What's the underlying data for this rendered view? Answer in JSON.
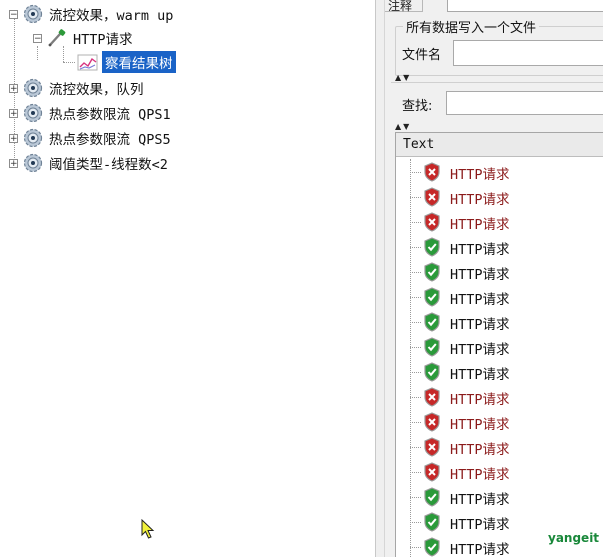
{
  "tree": {
    "items": [
      {
        "label": "流控效果，warm up",
        "expander": "−",
        "level": 0,
        "selected": false
      },
      {
        "label": "HTTP请求",
        "expander": "−",
        "level": 1,
        "selected": false
      },
      {
        "label": "察看结果树",
        "expander": "",
        "level": 2,
        "selected": true
      },
      {
        "label": "流控效果，队列",
        "expander": "+",
        "level": 0,
        "selected": false
      },
      {
        "label": "热点参数限流 QPS1",
        "expander": "+",
        "level": 0,
        "selected": false
      },
      {
        "label": "热点参数限流 QPS5",
        "expander": "+",
        "level": 0,
        "selected": false
      },
      {
        "label": "阈值类型-线程数<2",
        "expander": "+",
        "level": 0,
        "selected": false
      }
    ]
  },
  "right": {
    "top_tab_label": "注释",
    "file_group_title": "所有数据写入一个文件",
    "file_label": "文件名",
    "file_value": "",
    "search_label": "查找:",
    "search_value": "",
    "split_arrows": "▲▼"
  },
  "results": {
    "header": "Text",
    "items": [
      {
        "label": "HTTP请求",
        "status": "fail"
      },
      {
        "label": "HTTP请求",
        "status": "fail"
      },
      {
        "label": "HTTP请求",
        "status": "fail"
      },
      {
        "label": "HTTP请求",
        "status": "ok"
      },
      {
        "label": "HTTP请求",
        "status": "ok"
      },
      {
        "label": "HTTP请求",
        "status": "ok"
      },
      {
        "label": "HTTP请求",
        "status": "ok"
      },
      {
        "label": "HTTP请求",
        "status": "ok"
      },
      {
        "label": "HTTP请求",
        "status": "ok"
      },
      {
        "label": "HTTP请求",
        "status": "fail"
      },
      {
        "label": "HTTP请求",
        "status": "fail"
      },
      {
        "label": "HTTP请求",
        "status": "fail"
      },
      {
        "label": "HTTP请求",
        "status": "fail"
      },
      {
        "label": "HTTP请求",
        "status": "ok"
      },
      {
        "label": "HTTP请求",
        "status": "ok"
      },
      {
        "label": "HTTP请求",
        "status": "ok"
      }
    ]
  },
  "watermark": "yangeit",
  "colors": {
    "selection": "#1a63c7",
    "fail_text": "#8b1a1a",
    "ok_shield": "#2a9a3a",
    "fail_shield": "#c62828",
    "watermark": "#19883a"
  }
}
